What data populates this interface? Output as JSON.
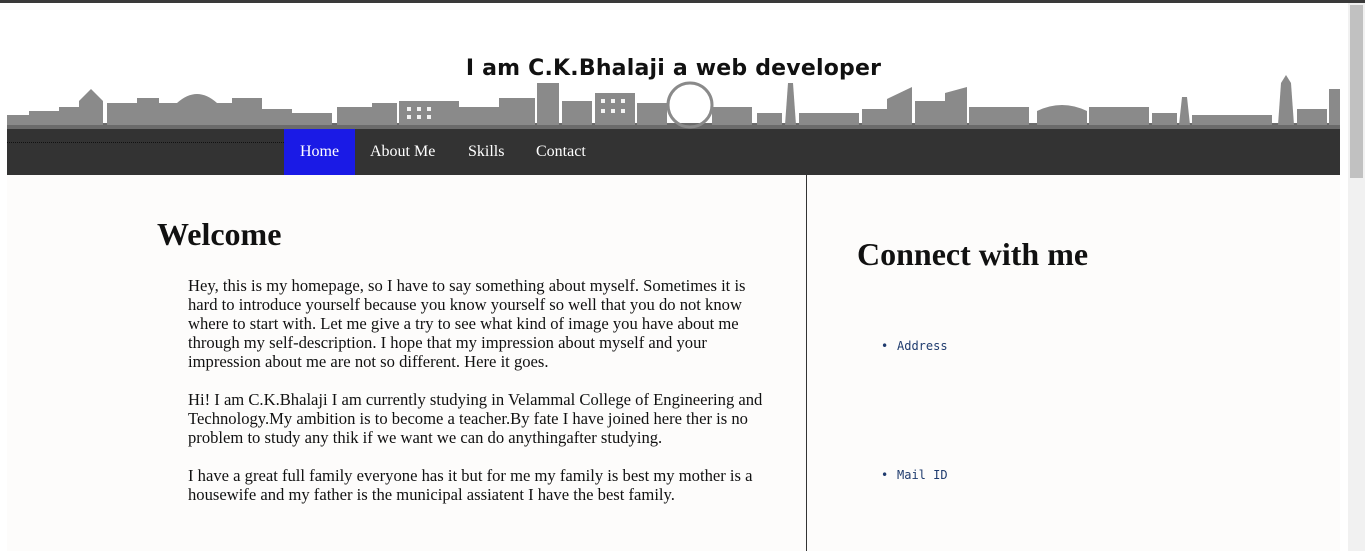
{
  "header": {
    "title": "I am C.K.Bhalaji a web developer"
  },
  "nav": {
    "items": [
      {
        "label": "Home",
        "active": true
      },
      {
        "label": "About Me",
        "active": false
      },
      {
        "label": "Skills",
        "active": false
      },
      {
        "label": "Contact",
        "active": false
      }
    ]
  },
  "main": {
    "heading": "Welcome",
    "paragraphs": [
      "Hey, this is my homepage, so I have to say something about myself. Sometimes it is hard to introduce yourself because you know yourself so well that you do not know where to start with. Let me give a try to see what kind of image you have about me through my self-description. I hope that my impression about myself and your impression about me are not so different. Here it goes.",
      "Hi! I am C.K.Bhalaji I am currently studying in Velammal College of Engineering and Technology.My ambition is to become a teacher.By fate I have joined here ther is no problem to study any thik if we want we can do anythingafter studying.",
      "I have a great full family everyone has it but for me my family is best my mother is a housewife and my father is the municipal assiatent I have the best family."
    ]
  },
  "sidebar": {
    "heading": "Connect with me",
    "items": [
      {
        "label": "Address"
      },
      {
        "label": "Mail ID"
      }
    ]
  },
  "colors": {
    "nav_bg": "#333333",
    "nav_active": "#1a1ae6",
    "link": "#1f3b6e"
  }
}
